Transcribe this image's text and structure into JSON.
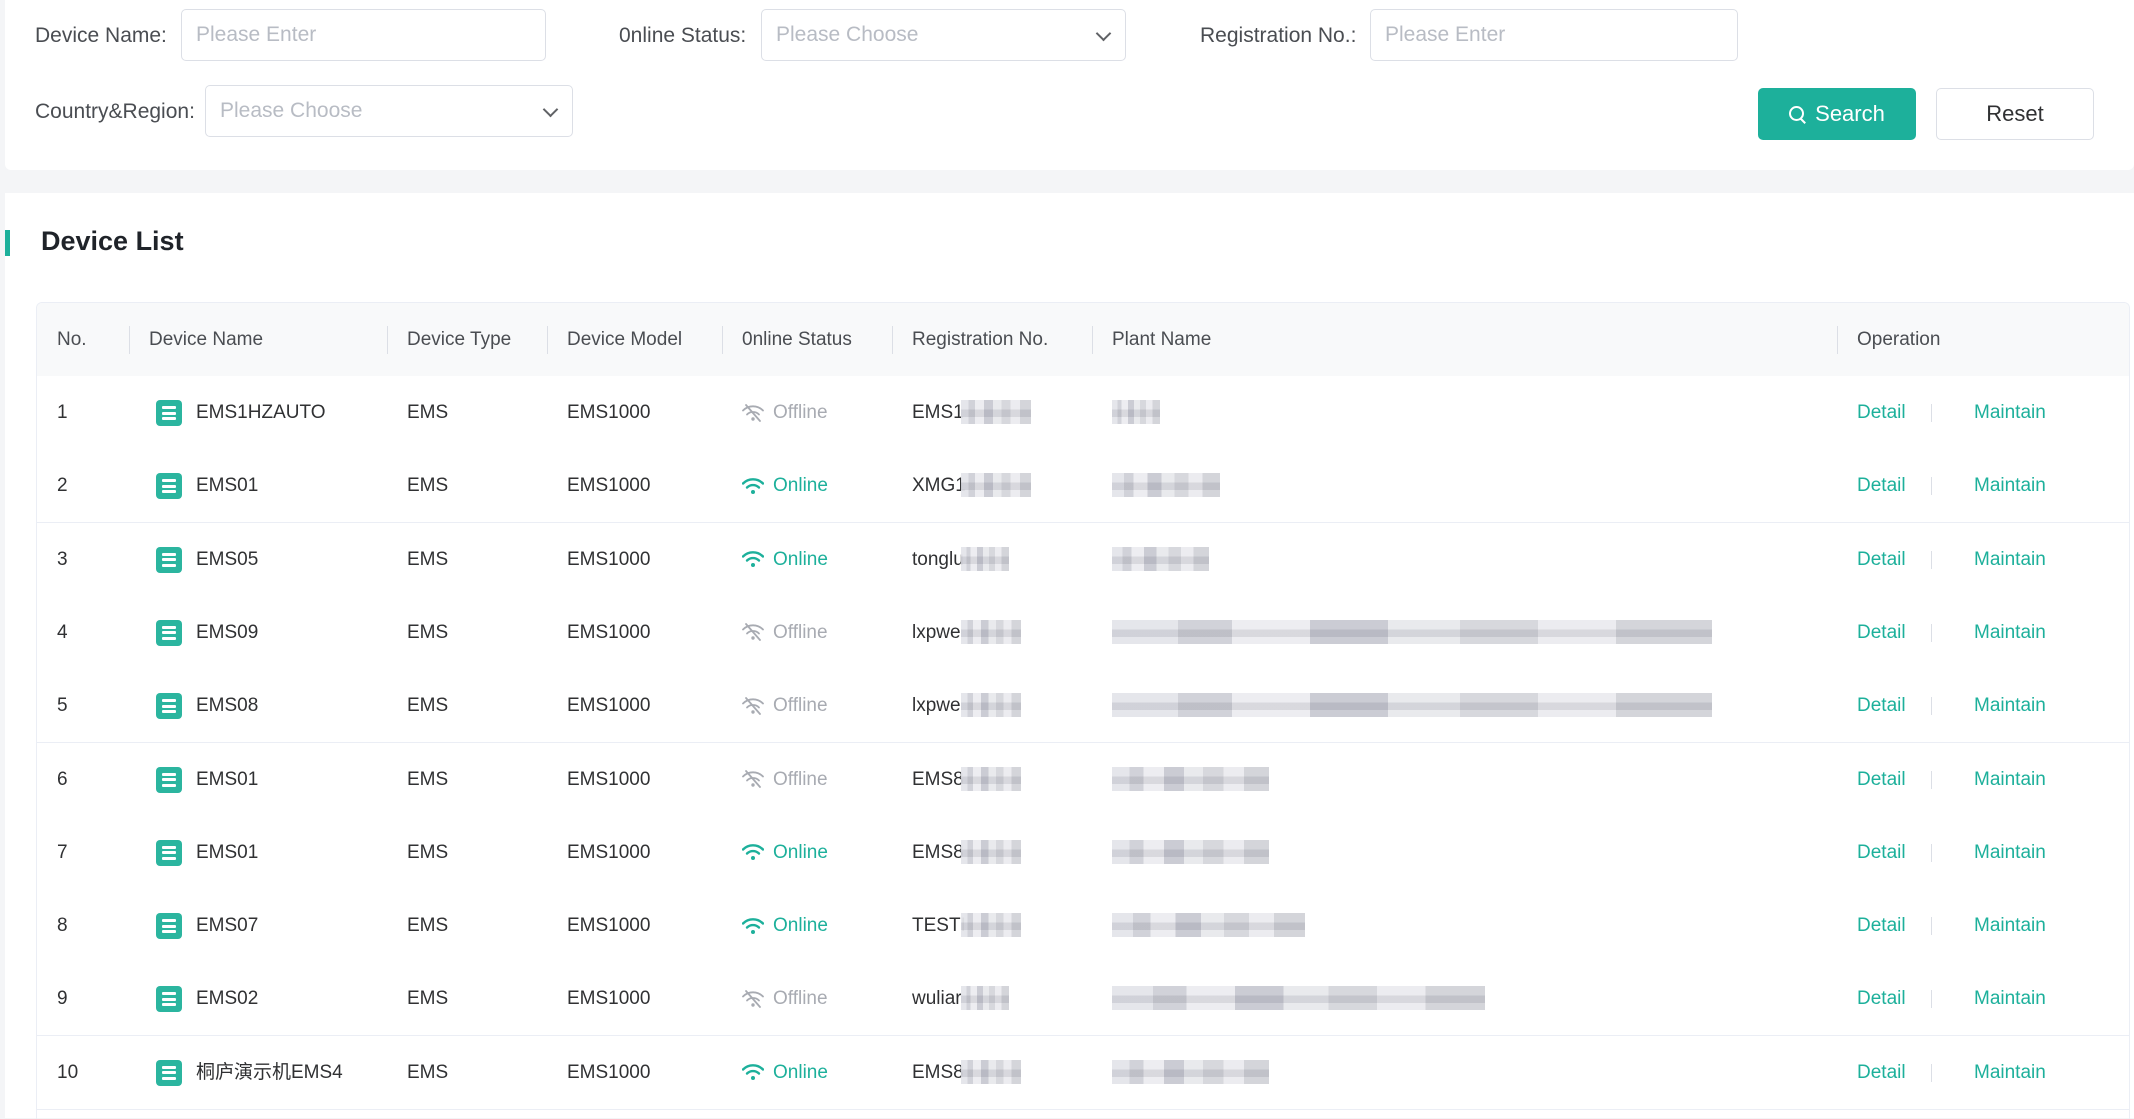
{
  "filters": {
    "device_name_label": "Device Name:",
    "device_name_placeholder": "Please Enter",
    "online_status_label": "0nline Status:",
    "online_status_placeholder": "Please Choose",
    "registration_label": "Registration No.:",
    "registration_placeholder": "Please Enter",
    "country_label": "Country&Region:",
    "country_placeholder": "Please Choose",
    "search_label": "Search",
    "reset_label": "Reset"
  },
  "device_list": {
    "title": "Device List",
    "columns": {
      "no": "No.",
      "device_name": "Device Name",
      "device_type": "Device Type",
      "device_model": "Device Model",
      "online_status": "0nline Status",
      "registration": "Registration No.",
      "plant_name": "Plant Name",
      "operation": "Operation"
    },
    "detail_label": "Detail",
    "maintain_label": "Maintain",
    "rows": [
      {
        "no": "1",
        "name": "EMS1HZAUTO",
        "type": "EMS",
        "model": "EMS1000",
        "status": "Offline",
        "reg": "EMS1"
      },
      {
        "no": "2",
        "name": "EMS01",
        "type": "EMS",
        "model": "EMS1000",
        "status": "Online",
        "reg": "XMG1"
      },
      {
        "no": "3",
        "name": "EMS05",
        "type": "EMS",
        "model": "EMS1000",
        "status": "Online",
        "reg": "tonglu"
      },
      {
        "no": "4",
        "name": "EMS09",
        "type": "EMS",
        "model": "EMS1000",
        "status": "Offline",
        "reg": "lxpwe"
      },
      {
        "no": "5",
        "name": "EMS08",
        "type": "EMS",
        "model": "EMS1000",
        "status": "Offline",
        "reg": "lxpwe"
      },
      {
        "no": "6",
        "name": "EMS01",
        "type": "EMS",
        "model": "EMS1000",
        "status": "Offline",
        "reg": "EMS8"
      },
      {
        "no": "7",
        "name": "EMS01",
        "type": "EMS",
        "model": "EMS1000",
        "status": "Online",
        "reg": "EMS8"
      },
      {
        "no": "8",
        "name": "EMS07",
        "type": "EMS",
        "model": "EMS1000",
        "status": "Online",
        "reg": "TESTI"
      },
      {
        "no": "9",
        "name": "EMS02",
        "type": "EMS",
        "model": "EMS1000",
        "status": "Offline",
        "reg": "wuliar"
      },
      {
        "no": "10",
        "name": "桐庐演示机EMS4",
        "type": "EMS",
        "model": "EMS1000",
        "status": "Online",
        "reg": "EMS8"
      }
    ]
  },
  "colors": {
    "accent": "#1db09b",
    "online": "#1db09b",
    "offline": "#a8abb2"
  },
  "icons": {
    "device": "device-list-icon",
    "online": "wifi-icon",
    "offline": "wifi-off-icon",
    "search": "search-icon",
    "select": "chevron-down-icon"
  }
}
